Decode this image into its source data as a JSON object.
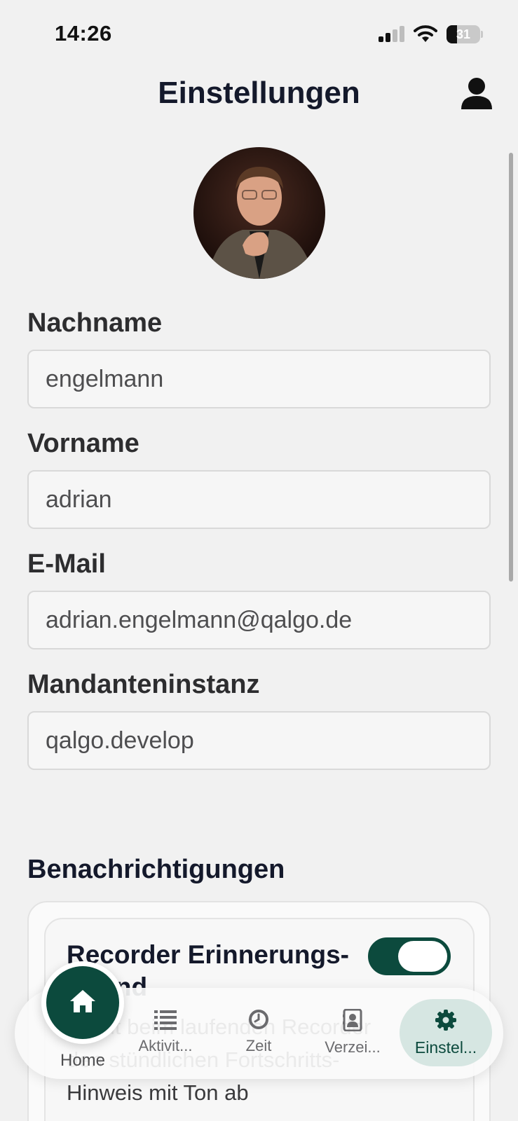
{
  "status_bar": {
    "time": "14:26",
    "battery_level": "31",
    "icons": [
      "signal-icon",
      "wifi-icon",
      "battery-icon"
    ]
  },
  "header": {
    "title": "Einstellungen",
    "profile_icon": "person-icon"
  },
  "profile": {
    "avatar": "user-photo"
  },
  "form": {
    "nachname": {
      "label": "Nachname",
      "value": "engelmann"
    },
    "vorname": {
      "label": "Vorname",
      "value": "adrian"
    },
    "email": {
      "label": "E-Mail",
      "value": "adrian.engelmann@qalgo.de"
    },
    "mandant": {
      "label": "Mandanteninstanz",
      "value": "qalgo.develop"
    }
  },
  "notifications": {
    "section_title": "Benachrichtigungen",
    "recorder": {
      "title": "Recorder Erinnerungs-Sound",
      "description": "Spielt beim laufenden Recorder den stündlichen Fortschritts-Hinweis mit Ton ab",
      "enabled": true
    }
  },
  "tabbar": {
    "home": {
      "label": "Home",
      "icon": "home-icon"
    },
    "activities": {
      "label": "Aktivit...",
      "icon": "list-icon"
    },
    "time": {
      "label": "Zeit",
      "icon": "clock-icon"
    },
    "directory": {
      "label": "Verzei...",
      "icon": "contact-card-icon"
    },
    "settings": {
      "label": "Einstel...",
      "icon": "gear-icon",
      "active": true
    }
  },
  "colors": {
    "accent": "#0c4a3d",
    "accent_light": "#d6e6e2",
    "background": "#f1f1f1"
  }
}
